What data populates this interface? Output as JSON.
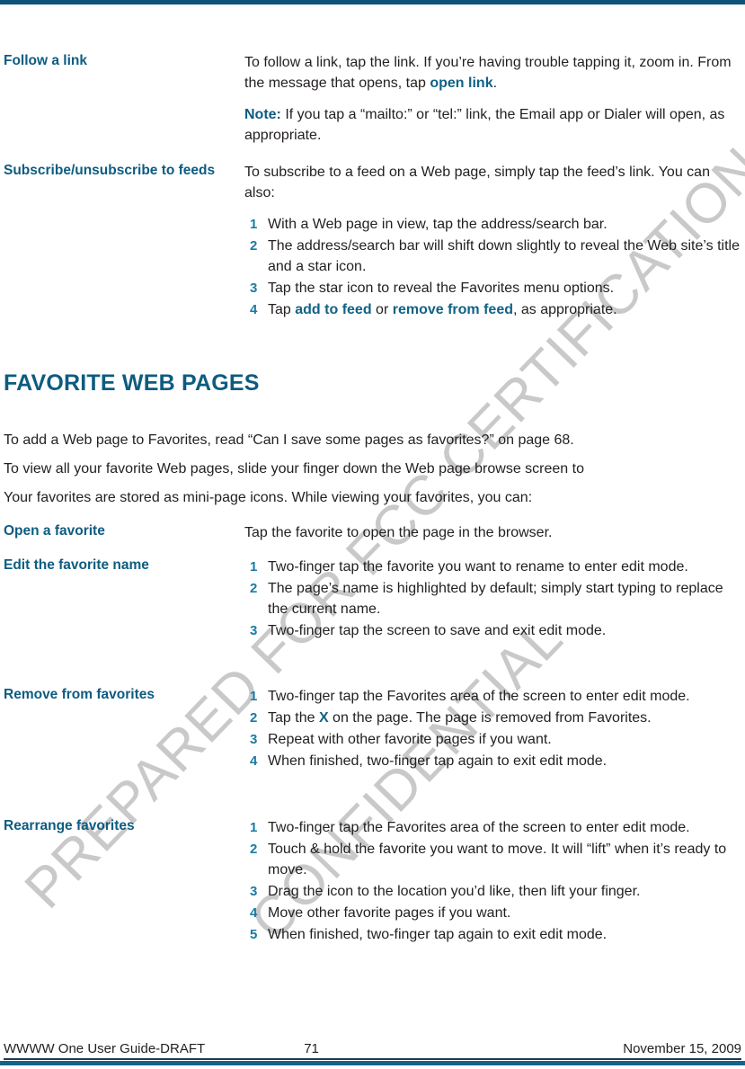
{
  "page": {
    "accent_color": "#0d5c80",
    "rule_color": "#15628a",
    "step_number_color": "#1a7ba3",
    "watermark_color": "#c9c9c9"
  },
  "watermark": {
    "line1": "PREPARED FOR FCC CERTIFICATION",
    "line2": "CONFIDENTIAL"
  },
  "rows": [
    {
      "label": "Follow a link",
      "para1_a": "To follow a link, tap the link. If you’re having trouble tapping it, zoom in. From the message that opens, tap ",
      "para1_link": "open link",
      "para1_b": ".",
      "note_label": "Note:",
      "note_text": " If you tap a “mailto:” or “tel:” link, the Email app or Dialer will open, as appropriate."
    },
    {
      "label": "Subscribe/unsubscribe to feeds",
      "intro": "To subscribe to a feed on a Web page, simply tap the feed’s link. You can also:",
      "steps": [
        "With a Web page in view, tap the address/search bar.",
        "The address/search bar will shift down slightly to reveal the Web site’s title and a star icon.",
        "Tap the star icon to reveal the Favorites menu options."
      ],
      "step4_a": "Tap ",
      "step4_link1": "add to feed",
      "step4_mid": " or ",
      "step4_link2": "remove from feed",
      "step4_b": ", as appropriate."
    }
  ],
  "section": {
    "heading": "FAVORITE WEB PAGES",
    "intro_para1": "To add a Web page to Favorites, read “Can I save some pages as favorites?” on page 68.",
    "intro_para2": "To view all your favorite Web pages, slide your finger down the Web page browse screen to",
    "intro_para3": "Your favorites are stored as mini-page icons. While viewing your favorites, you can:"
  },
  "favorite_rows": [
    {
      "label": "Open a favorite",
      "body": "Tap the favorite to open the page in the browser."
    },
    {
      "label": "Edit the favorite name",
      "steps": [
        "Two-finger tap the favorite you want to rename to enter edit mode.",
        "The page’s name is highlighted by default; simply start typing to replace the current name.",
        "Two-finger tap the screen to save and exit edit mode."
      ]
    },
    {
      "label": "Remove from favorites",
      "steps_pre": "Two-finger tap the Favorites area of the screen to enter edit mode.",
      "step2_a": "Tap the ",
      "step2_x": "X",
      "step2_b": " on the page. The page is removed from Favorites.",
      "steps_post": [
        "Repeat with other favorite pages if you want.",
        "When finished, two-finger tap again to exit edit mode."
      ]
    },
    {
      "label": "Rearrange favorites",
      "steps": [
        "Two-finger tap the Favorites area of the screen to enter edit mode.",
        "Touch & hold the favorite you want to move. It will “lift” when it’s ready to move.",
        "Drag the icon to the location you’d like, then lift your finger.",
        "Move other favorite pages if you want.",
        "When finished, two-finger tap again to exit edit mode."
      ]
    }
  ],
  "footer": {
    "left": "WWWW One User Guide-DRAFT",
    "page_number": "71",
    "right": "November 15, 2009"
  }
}
